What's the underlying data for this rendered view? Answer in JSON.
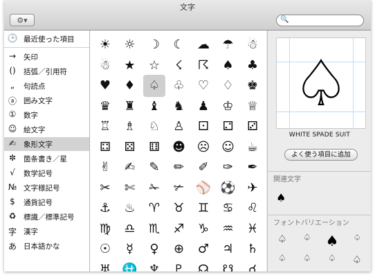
{
  "window": {
    "title": "文字"
  },
  "toolbar": {
    "gear_icon": "⚙▾",
    "search_placeholder": "",
    "search_icon": "🔍"
  },
  "sidebar": {
    "items": [
      {
        "icon": "🕒",
        "label": "最近使った項目"
      },
      {
        "icon": "→",
        "label": "矢印"
      },
      {
        "icon": "()",
        "label": "括弧／引用符"
      },
      {
        "icon": "„",
        "label": "句読点"
      },
      {
        "icon": "ⓐ",
        "label": "囲み文字"
      },
      {
        "icon": "①",
        "label": "数字"
      },
      {
        "icon": "☺",
        "label": "絵文字"
      },
      {
        "icon": "✍",
        "label": "象形文字",
        "selected": true
      },
      {
        "icon": "✼",
        "label": "箇条書き／星"
      },
      {
        "icon": "√",
        "label": "数学記号"
      },
      {
        "icon": "№",
        "label": "文字様記号"
      },
      {
        "icon": "$",
        "label": "通貨記号"
      },
      {
        "icon": "♻",
        "label": "標識／標準記号"
      },
      {
        "icon": "字",
        "label": "漢字"
      },
      {
        "icon": "あ",
        "label": "日本語かな"
      }
    ]
  },
  "grid": {
    "rows": [
      [
        "☀",
        "☼",
        "☽",
        "☾",
        "☁",
        "☂",
        "☃"
      ],
      [
        "☃",
        "★",
        "☆",
        "☇",
        "☈",
        "♠",
        "♣"
      ],
      [
        "♥",
        "♦",
        "♤",
        "♧",
        "♡",
        "♢",
        "♚"
      ],
      [
        "♛",
        "♜",
        "♝",
        "♞",
        "♟",
        "♔",
        "♕"
      ],
      [
        "♖",
        "♗",
        "♘",
        "♙",
        "⚀",
        "⚁",
        "⚂"
      ],
      [
        "⚃",
        "⚄",
        "⚅",
        "☻",
        "☹",
        "☺",
        "☕"
      ],
      [
        "✌",
        "✍",
        "✎",
        "✏",
        "✐",
        "✑",
        "✒"
      ],
      [
        "✂",
        "✄",
        "✁",
        "✃",
        "⚾",
        "⚽",
        "✈"
      ],
      [
        "⚓",
        "♨",
        "♈",
        "♉",
        "♊",
        "♋",
        "♌"
      ],
      [
        "♍",
        "♎",
        "♏",
        "♐",
        "♑",
        "♒",
        "♓"
      ],
      [
        "☉",
        "☿",
        "♀",
        "⊕",
        "♂",
        "♃",
        "♄"
      ],
      [
        "♅",
        "⛎",
        "♆",
        "♇",
        "☊",
        "☋",
        "☌"
      ]
    ],
    "selected": "♤"
  },
  "detail": {
    "glyph": "♤",
    "name": "WHITE SPADE SUIT",
    "add_favorite_label": "よく使う項目に追加",
    "related_header": "関連文字",
    "related": [
      "♠"
    ],
    "variations_header": "フォントバリエーション",
    "variations": [
      "♤",
      "♤",
      "♠",
      "♤",
      "♤",
      "♤",
      "♤",
      "♤"
    ]
  }
}
